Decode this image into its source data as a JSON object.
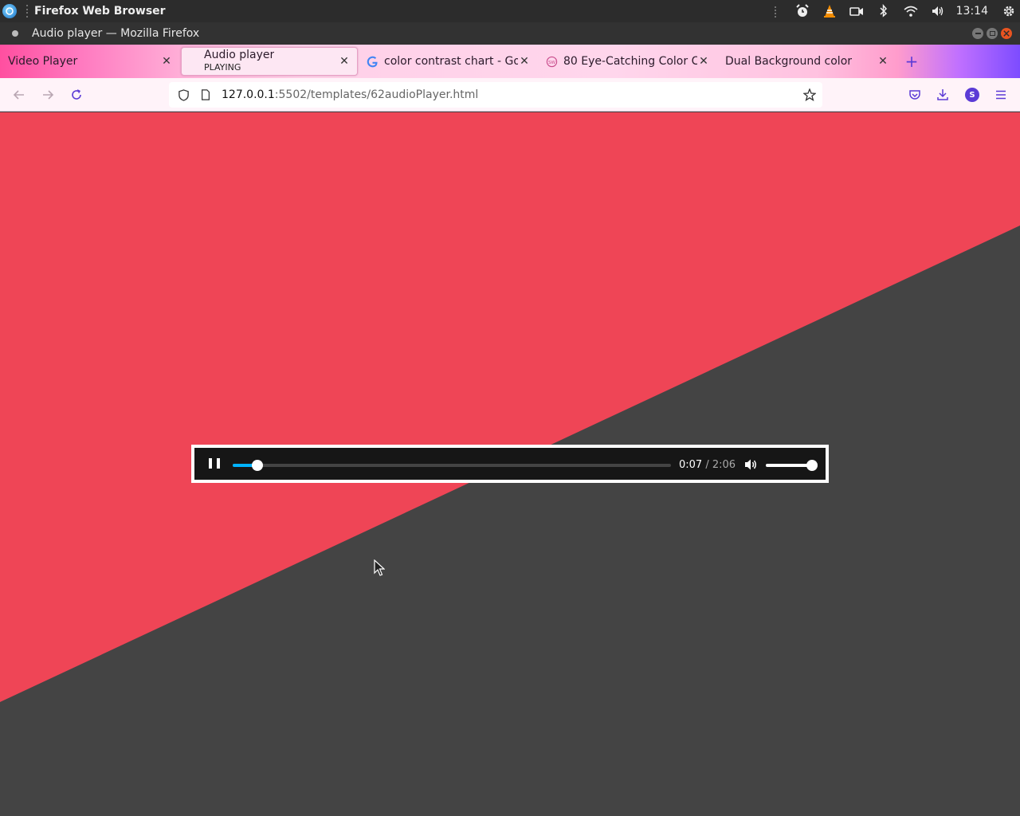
{
  "system": {
    "app_name": "Firefox Web Browser",
    "clock": "13:14"
  },
  "window": {
    "title": "Audio player — Mozilla Firefox"
  },
  "tabs": [
    {
      "label": "Video Player",
      "active": false
    },
    {
      "label": "Audio player",
      "sublabel": "PLAYING",
      "active": true
    },
    {
      "label": "color contrast chart - Goo",
      "active": false
    },
    {
      "label": "80 Eye-Catching Color Co",
      "active": false
    },
    {
      "label": "Dual Background color",
      "active": false
    }
  ],
  "navbar": {
    "url_host": "127.0.0.1",
    "url_rest": ":5502/templates/62audioPlayer.html",
    "profile_initial": "S"
  },
  "page": {
    "top_color": "#ef4556",
    "bottom_color": "#444444"
  },
  "player": {
    "state": "playing",
    "current_time": "0:07",
    "separator": " / ",
    "duration": "2:06",
    "progress_fraction": 0.0556,
    "volume_fraction": 1.0,
    "accent_color": "#00b3ff"
  }
}
